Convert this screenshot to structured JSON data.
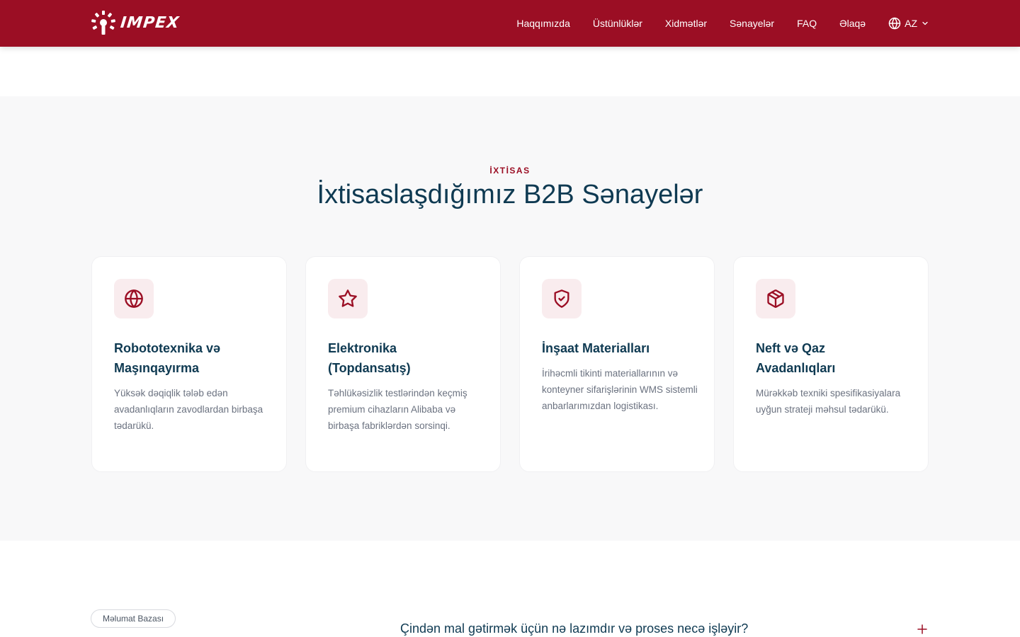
{
  "header": {
    "brand": "IMPEX",
    "nav": [
      "Haqqımızda",
      "Üstünlüklər",
      "Xidmətlər",
      "Sənayelər",
      "FAQ",
      "Əlaqə"
    ],
    "language": "AZ"
  },
  "industries": {
    "eyebrow": "İXTİSAS",
    "title": "İxtisaslaşdığımız B2B Sənayelər",
    "cards": [
      {
        "icon": "globe-icon",
        "title": "Robototexnika və Maşınqayırma",
        "desc": "Yüksək dəqiqlik tələb edən avadanlıqların zavodlardan birbaşa tədarükü."
      },
      {
        "icon": "star-icon",
        "title": "Elektronika (Topdansatış)",
        "desc": "Təhlükəsizlik testlərindən keçmiş premium cihazların Alibaba və birbaşa fabriklərdən sorsinqi."
      },
      {
        "icon": "shield-check-icon",
        "title": "İnşaat Materialları",
        "desc": "İrihəcmli tikinti materiallarının və konteyner sifarişlərinin WMS sistemli anbarlarımızdan logistikası."
      },
      {
        "icon": "box-icon",
        "title": "Neft və Qaz Avadanlıqları",
        "desc": "Mürəkkəb texniki spesifikasiyalara uyğun strateji məhsul tədarükü."
      }
    ]
  },
  "knowledge": {
    "badge": "Məlumat Bazası",
    "question": "Çindən mal gətirmək üçün nə lazımdır və proses necə işləyir?"
  },
  "colors": {
    "brand": "#9b0e24",
    "title": "#0f3a52",
    "icon_bg": "#f9ecee"
  }
}
